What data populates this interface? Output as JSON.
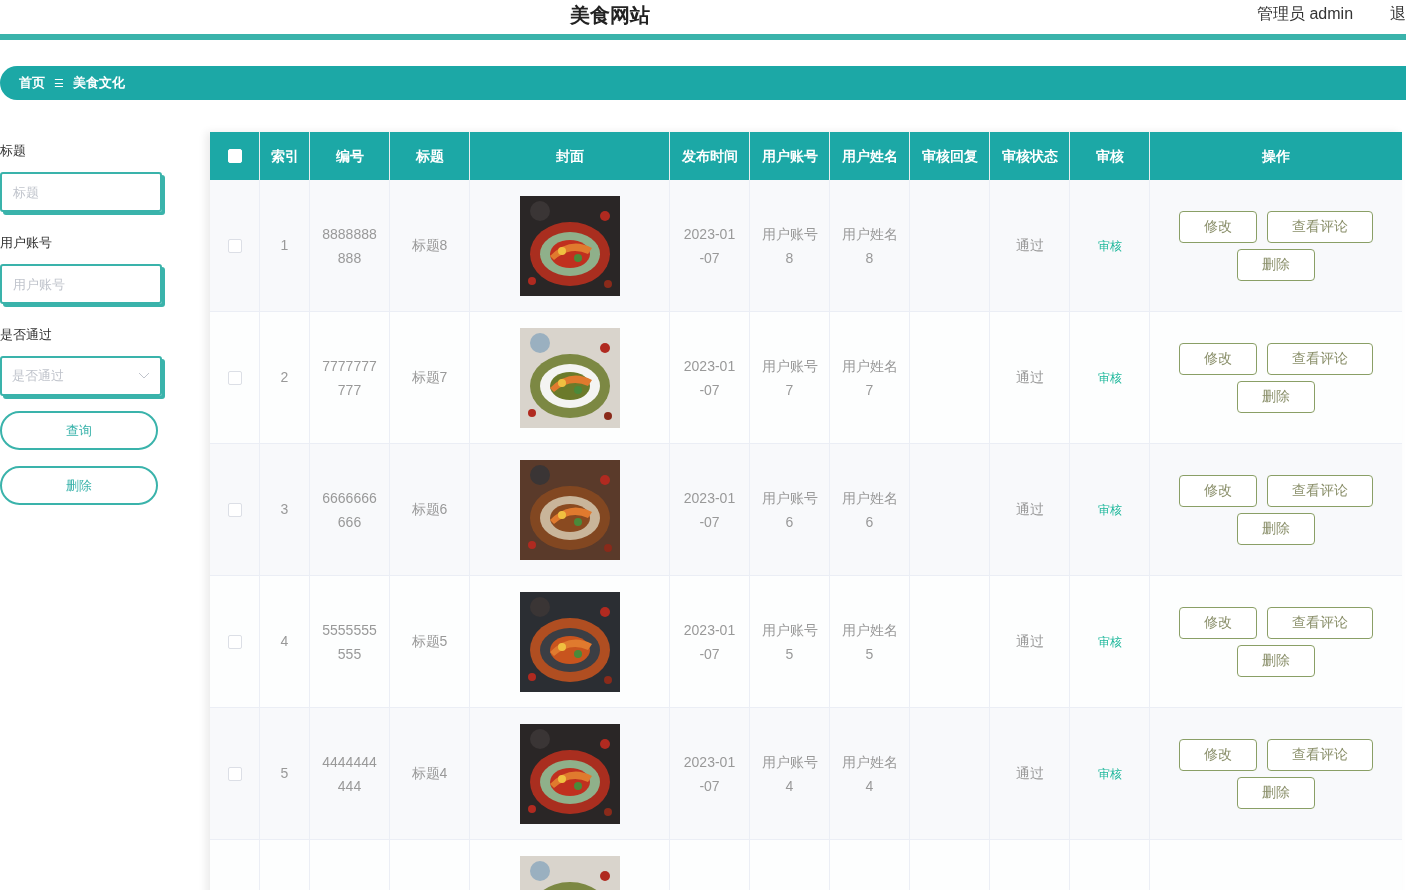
{
  "header": {
    "title": "美食网站",
    "user": "管理员 admin",
    "logout": "退"
  },
  "breadcrumb": {
    "home": "首页",
    "separator": "☰",
    "current": "美食文化"
  },
  "filters": [
    {
      "kind": "input",
      "label": "标题",
      "placeholder": "标题"
    },
    {
      "kind": "input",
      "label": "用户账号",
      "placeholder": "用户账号"
    },
    {
      "kind": "select",
      "label": "是否通过",
      "placeholder": "是否通过"
    }
  ],
  "filter_buttons": [
    "查询",
    "删除"
  ],
  "table": {
    "select_all": {
      "checked": false
    },
    "columns": [
      "索引",
      "编号",
      "标题",
      "封面",
      "发布时间",
      "用户账号",
      "用户姓名",
      "审核回复",
      "审核状态",
      "审核",
      "操作"
    ],
    "rows": [
      {
        "checked": false,
        "index": "1",
        "code": "8888888888",
        "title": "标题8",
        "cover": {
          "kind": "picture"
        },
        "time": "2023-01-07",
        "account": "用户账号8",
        "name": "用户姓名8",
        "status": "通过",
        "audit": "审核",
        "actions": [
          "修改",
          "查看评论",
          "删除"
        ]
      },
      {
        "checked": false,
        "index": "2",
        "code": "7777777777",
        "title": "标题7",
        "cover": {
          "kind": "picture"
        },
        "time": "2023-01-07",
        "account": "用户账号7",
        "name": "用户姓名7",
        "status": "通过",
        "audit": "审核",
        "actions": [
          "修改",
          "查看评论",
          "删除"
        ]
      },
      {
        "checked": false,
        "index": "3",
        "code": "6666666666",
        "title": "标题6",
        "cover": {
          "kind": "picture"
        },
        "time": "2023-01-07",
        "account": "用户账号6",
        "name": "用户姓名6",
        "status": "通过",
        "audit": "审核",
        "actions": [
          "修改",
          "查看评论",
          "删除"
        ]
      },
      {
        "checked": false,
        "index": "4",
        "code": "5555555555",
        "title": "标题5",
        "cover": {
          "kind": "picture"
        },
        "time": "2023-01-07",
        "account": "用户账号5",
        "name": "用户姓名5",
        "status": "通过",
        "audit": "审核",
        "actions": [
          "修改",
          "查看评论",
          "删除"
        ]
      },
      {
        "checked": false,
        "index": "5",
        "code": "4444444444",
        "title": "标题4",
        "cover": {
          "kind": "picture"
        },
        "time": "2023-01-07",
        "account": "用户账号4",
        "name": "用户姓名4",
        "status": "通过",
        "audit": "审核",
        "actions": [
          "修改",
          "查看评论",
          "删除"
        ]
      },
      {
        "cover": {
          "kind": "picture"
        }
      }
    ]
  }
}
